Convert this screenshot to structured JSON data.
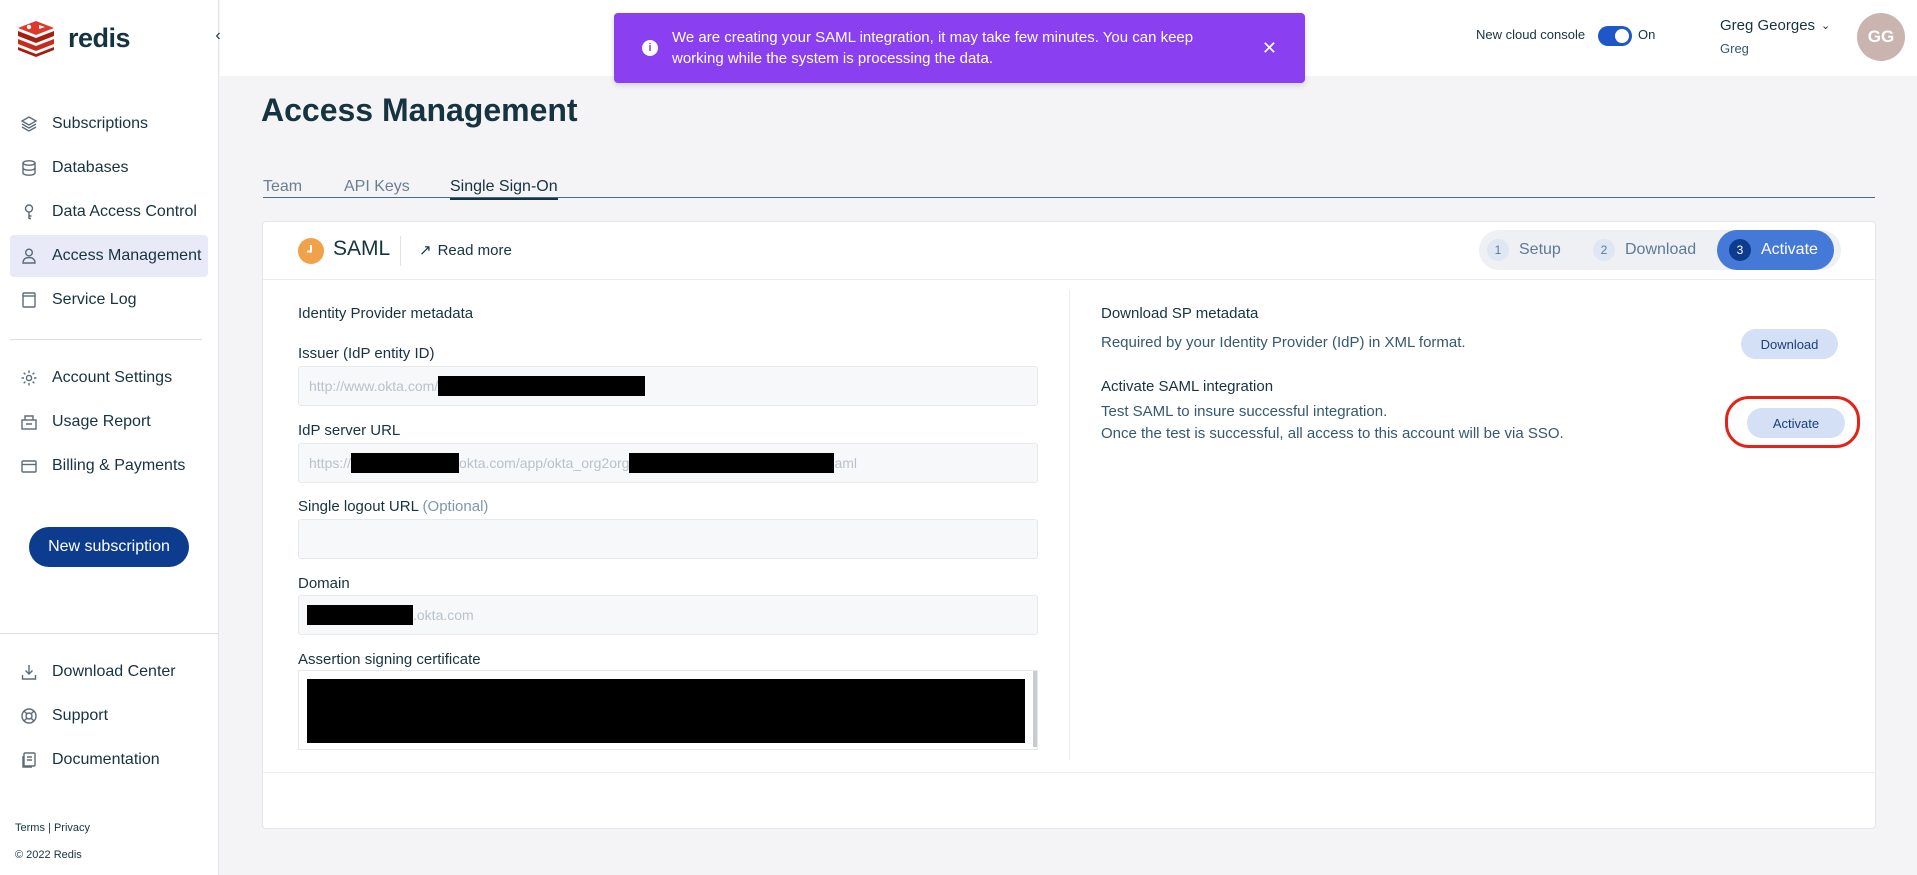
{
  "brand": {
    "name": "redis"
  },
  "sidebar": {
    "items": [
      {
        "label": "Subscriptions",
        "icon": "layers-icon"
      },
      {
        "label": "Databases",
        "icon": "database-icon"
      },
      {
        "label": "Data Access Control",
        "icon": "key-icon"
      },
      {
        "label": "Access Management",
        "icon": "user-icon",
        "active": true
      },
      {
        "label": "Service Log",
        "icon": "log-icon"
      }
    ],
    "items2": [
      {
        "label": "Account Settings",
        "icon": "gear-icon"
      },
      {
        "label": "Usage Report",
        "icon": "report-icon"
      },
      {
        "label": "Billing & Payments",
        "icon": "card-icon"
      }
    ],
    "new_subscription": "New subscription",
    "bottom_items": [
      {
        "label": "Download Center",
        "icon": "download-icon"
      },
      {
        "label": "Support",
        "icon": "lifebuoy-icon"
      },
      {
        "label": "Documentation",
        "icon": "docs-icon"
      }
    ],
    "terms": "Terms",
    "privacy": "Privacy",
    "copyright": "© 2022 Redis"
  },
  "toast": {
    "message": "We are creating your SAML integration, it may take few minutes. You can keep working while the system is processing the data.",
    "color": "#8a3ff0"
  },
  "header": {
    "console_label": "New cloud console",
    "toggle_state": "On",
    "user_name": "Greg Georges",
    "user_sub": "Greg",
    "avatar_initials": "GG"
  },
  "page": {
    "title": "Access Management",
    "tabs": [
      {
        "label": "Team"
      },
      {
        "label": "API Keys"
      },
      {
        "label": "Single Sign-On",
        "active": true
      }
    ]
  },
  "saml": {
    "title": "SAML",
    "read_more": "Read more",
    "steps": [
      {
        "num": "1",
        "label": "Setup"
      },
      {
        "num": "2",
        "label": "Download"
      },
      {
        "num": "3",
        "label": "Activate",
        "active": true
      }
    ],
    "idp_heading": "Identity Provider metadata",
    "issuer_label": "Issuer (IdP entity ID)",
    "issuer_value_prefix": "http://www.okta.com/",
    "server_url_label": "IdP server URL",
    "server_url_prefix": "https://",
    "server_url_mid": "okta.com/app/okta_org2org",
    "server_url_suffix": "aml",
    "logout_label": "Single logout URL",
    "logout_optional": "(Optional)",
    "domain_label": "Domain",
    "domain_suffix": ".okta.com",
    "cert_label": "Assertion signing certificate",
    "sp_heading": "Download SP metadata",
    "sp_text": "Required by your Identity Provider (IdP) in XML format.",
    "download_btn": "Download",
    "activate_heading": "Activate SAML integration",
    "activate_text1": "Test SAML to insure successful integration.",
    "activate_text2": "Once the test is successful, all access to this account will be via SSO.",
    "activate_btn": "Activate"
  }
}
